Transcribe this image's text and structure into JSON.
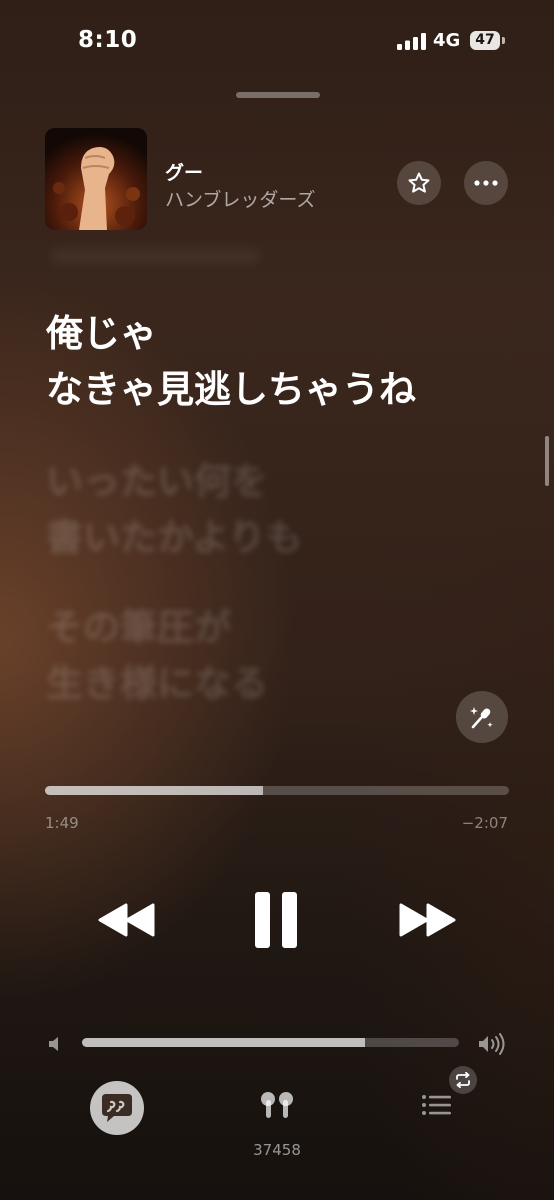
{
  "status": {
    "time": "8:10",
    "network": "4G",
    "battery": "47"
  },
  "now_playing": {
    "title": "グー",
    "artist": "ハンブレッダーズ"
  },
  "lyrics": {
    "current": [
      "俺じゃ",
      "なきゃ見逃しちゃうね"
    ],
    "upcoming": [
      "いったい何を",
      "書いたかよりも",
      "その筆圧が",
      "生き様になる"
    ]
  },
  "playback": {
    "elapsed": "1:49",
    "remaining": "−2:07",
    "progress_fraction": 0.47,
    "volume_fraction": 0.75
  },
  "output_device": {
    "label": "37458"
  },
  "icons": {
    "favorite": "star-icon",
    "more": "ellipsis-icon",
    "sing": "microphone-sparkle-icon",
    "rewind": "rewind-icon",
    "pause": "pause-icon",
    "forward": "fast-forward-icon",
    "lyrics": "quote-bubble-icon",
    "airplay": "airpods-icon",
    "queue": "list-icon",
    "repeat": "repeat-icon"
  },
  "colors": {
    "accent": "#ffffff"
  }
}
